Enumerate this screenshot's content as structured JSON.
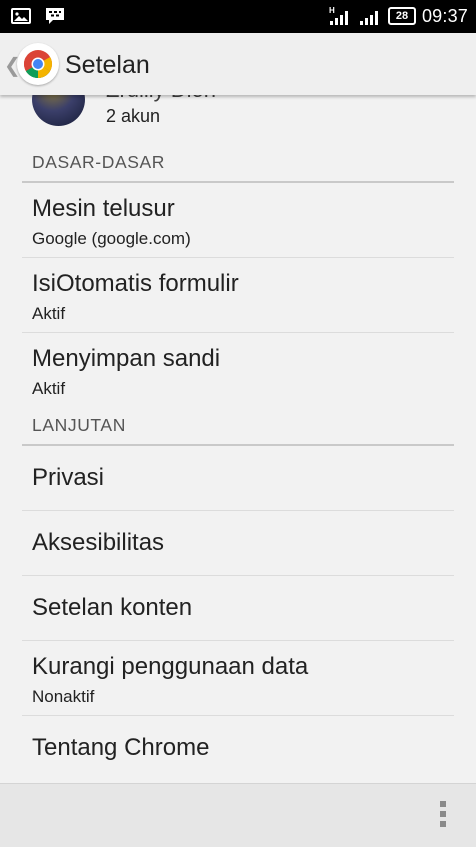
{
  "status_bar": {
    "network_type": "H",
    "battery_level": "28",
    "time": "09:37",
    "left_icons": [
      "image-icon",
      "bbm-icon"
    ]
  },
  "action_bar": {
    "title": "Setelan",
    "app_icon": "chrome-logo-icon"
  },
  "account": {
    "name_partial": "Zrulliy Dion",
    "subtitle": "2 akun"
  },
  "sections": {
    "basics": {
      "header": "DASAR-DASAR",
      "items": [
        {
          "label": "Mesin telusur",
          "sub": "Google (google.com)"
        },
        {
          "label": "IsiOtomatis formulir",
          "sub": "Aktif"
        },
        {
          "label": "Menyimpan sandi",
          "sub": "Aktif"
        }
      ]
    },
    "advanced": {
      "header": "LANJUTAN",
      "items": [
        {
          "label": "Privasi"
        },
        {
          "label": "Aksesibilitas"
        },
        {
          "label": "Setelan konten"
        },
        {
          "label": "Kurangi penggunaan data",
          "sub": "Nonaktif"
        },
        {
          "label": "Tentang Chrome"
        }
      ]
    }
  },
  "bottom_bar": {
    "menu_icon": "overflow-menu-icon"
  },
  "colors": {
    "status_bar_bg": "#000000",
    "action_bar_bg": "#efefef",
    "page_bg": "#f2f2f2",
    "divider": "#c9c9c9"
  }
}
